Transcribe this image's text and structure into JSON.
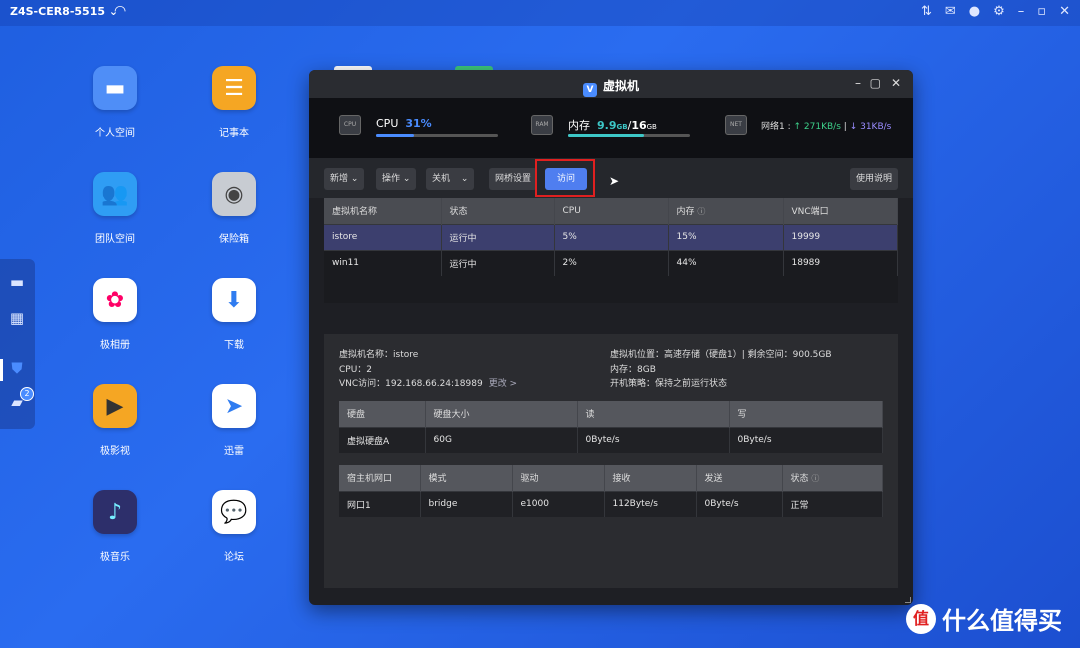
{
  "topbar": {
    "host": "Z4S-CER8-5515",
    "host_caret": "⌄"
  },
  "dock": {
    "badge": "2"
  },
  "desktop": [
    {
      "label": "个人空间",
      "icon": "folder-icon",
      "color": "#4f8ef7"
    },
    {
      "label": "记事本",
      "icon": "notepad-icon",
      "color": "#f5a623"
    },
    {
      "label": "团队空间",
      "icon": "team-folder-icon",
      "color": "#2f9df4"
    },
    {
      "label": "保险箱",
      "icon": "safe-icon",
      "color": "#c8ccd2"
    },
    {
      "label": "极相册",
      "icon": "photos-icon",
      "color": "#ffffff"
    },
    {
      "label": "下载",
      "icon": "download-icon",
      "color": "#ffffff"
    },
    {
      "label": "极影视",
      "icon": "video-icon",
      "color": "#f5a623"
    },
    {
      "label": "迅雷",
      "icon": "thunder-icon",
      "color": "#ffffff"
    },
    {
      "label": "极音乐",
      "icon": "music-icon",
      "color": "#2d2f6b"
    },
    {
      "label": "论坛",
      "icon": "forum-icon",
      "color": "#ffffff"
    }
  ],
  "window": {
    "title": "虚拟机",
    "stats": {
      "cpu_label": "CPU",
      "cpu_value": "31%",
      "cpu_fraction": 0.31,
      "mem_label": "内存",
      "mem_used": "9.9",
      "mem_used_unit": "GB",
      "mem_sep": "/",
      "mem_total": "16",
      "mem_total_unit": "GB",
      "mem_fraction": 0.62,
      "net_label": "网络1 :",
      "net_up": "↑ 271KB/s",
      "net_sep": "|",
      "net_down": "↓ 31KB/s",
      "chip_cpu": "CPU",
      "chip_mem": "RAM",
      "chip_net": "NET"
    },
    "toolbar": {
      "new": "新增",
      "ops": "操作",
      "shutdown": "关机",
      "bridge": "网桥设置",
      "access": "访问",
      "help": "使用说明",
      "caret": "⌄"
    },
    "vm_table": {
      "headers": [
        "虚拟机名称",
        "状态",
        "CPU",
        "内存",
        "VNC端口"
      ],
      "rows": [
        [
          "istore",
          "运行中",
          "5%",
          "15%",
          "19999"
        ],
        [
          "win11",
          "运行中",
          "2%",
          "44%",
          "18989"
        ]
      ]
    },
    "detail": {
      "name": "虚拟机名称：istore",
      "cpu": "CPU：2",
      "vnc": "VNC访问：192.168.66.24:18989",
      "vnc_change": "更改 >",
      "location": "虚拟机位置：高速存储（硬盘1）| 剩余空间：900.5GB",
      "memory": "内存：8GB",
      "boot": "开机策略：保持之前运行状态",
      "disk_table": {
        "headers": [
          "硬盘",
          "硬盘大小",
          "读",
          "写"
        ],
        "rows": [
          [
            "虚拟硬盘A",
            "60G",
            "0Byte/s",
            "0Byte/s"
          ]
        ]
      },
      "nic_table": {
        "headers": [
          "宿主机网口",
          "模式",
          "驱动",
          "接收",
          "发送",
          "状态"
        ],
        "rows": [
          [
            "网口1",
            "bridge",
            "e1000",
            "112Byte/s",
            "0Byte/s",
            "正常"
          ]
        ]
      }
    }
  },
  "watermark": {
    "logo": "值",
    "text": "什么值得买"
  }
}
